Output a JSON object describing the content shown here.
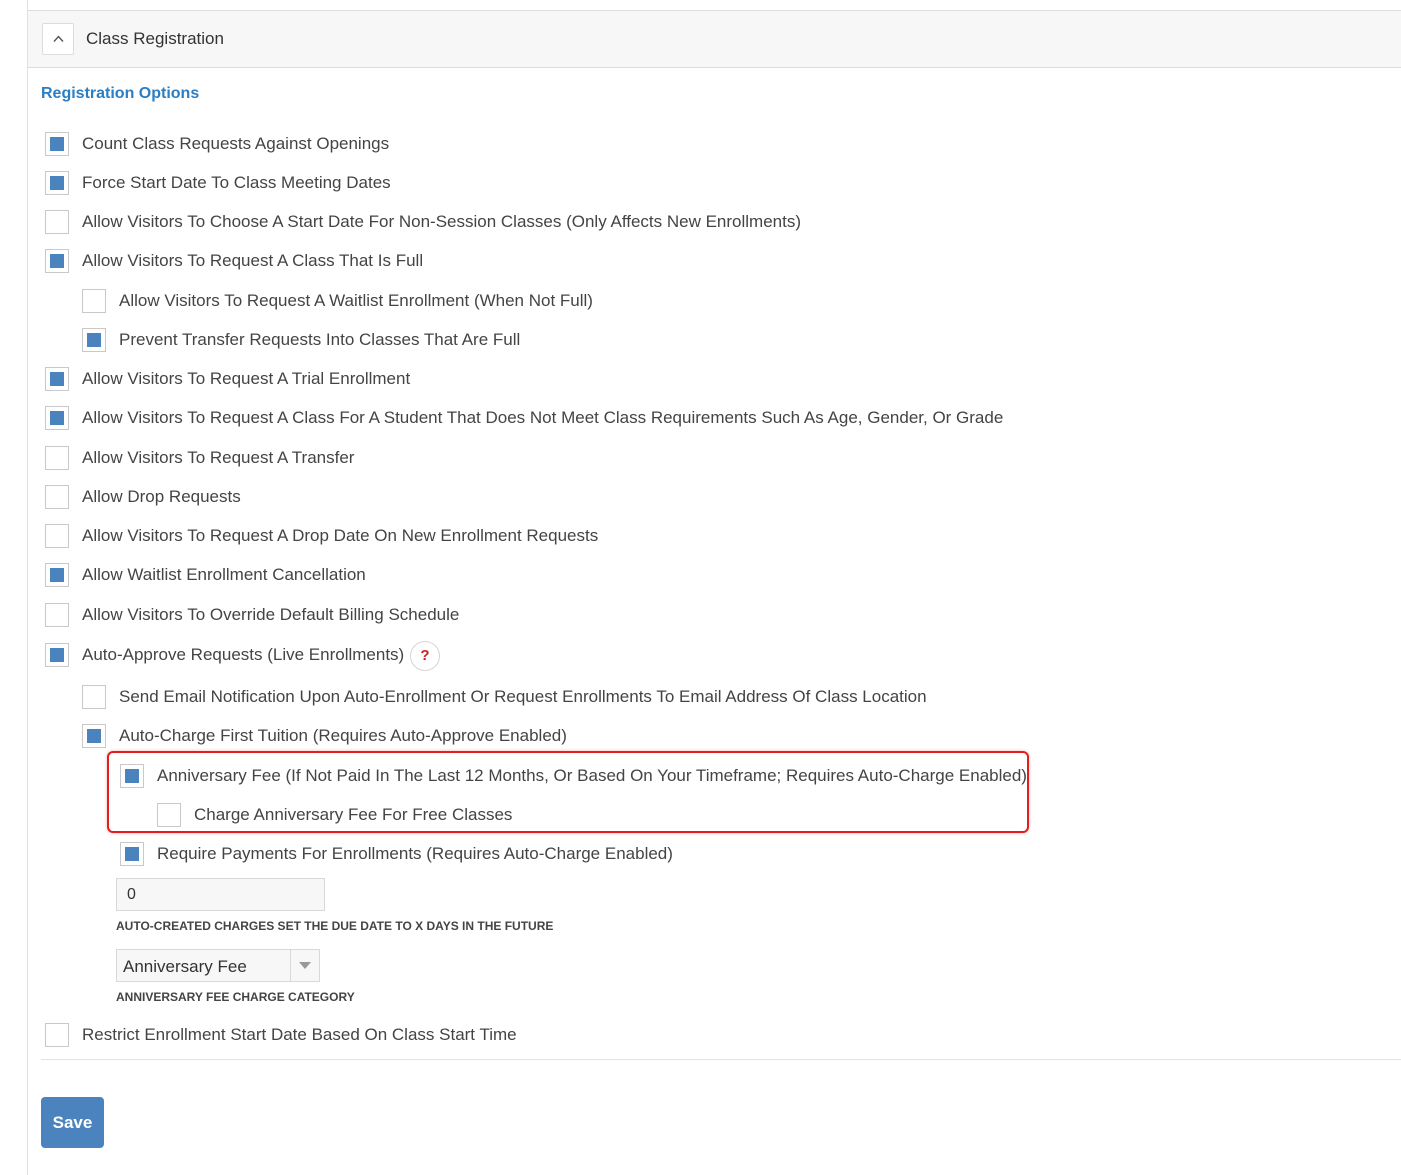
{
  "panel": {
    "title": "Class Registration",
    "section_title": "Registration Options"
  },
  "options": [
    {
      "label": "Count Class Requests Against Openings",
      "checked": true
    },
    {
      "label": "Force Start Date To Class Meeting Dates",
      "checked": true
    },
    {
      "label": "Allow Visitors To Choose A Start Date For Non-Session Classes (Only Affects New Enrollments)",
      "checked": false
    },
    {
      "label": "Allow Visitors To Request A Class That Is Full",
      "checked": true
    },
    {
      "label": "Allow Visitors To Request A Waitlist Enrollment (When Not Full)",
      "checked": false
    },
    {
      "label": "Prevent Transfer Requests Into Classes That Are Full",
      "checked": true
    },
    {
      "label": "Allow Visitors To Request A Trial Enrollment",
      "checked": true
    },
    {
      "label": "Allow Visitors To Request A Class For A Student That Does Not Meet Class Requirements Such As Age, Gender, Or Grade",
      "checked": true
    },
    {
      "label": "Allow Visitors To Request A Transfer",
      "checked": false
    },
    {
      "label": "Allow Drop Requests",
      "checked": false
    },
    {
      "label": "Allow Visitors To Request A Drop Date On New Enrollment Requests",
      "checked": false
    },
    {
      "label": "Allow Waitlist Enrollment Cancellation",
      "checked": true
    },
    {
      "label": "Allow Visitors To Override Default Billing Schedule",
      "checked": false
    },
    {
      "label": "Auto-Approve Requests (Live Enrollments)",
      "checked": true
    },
    {
      "label": "Send Email Notification Upon Auto-Enrollment Or Request Enrollments To Email Address Of Class Location",
      "checked": false
    },
    {
      "label": "Auto-Charge First Tuition (Requires Auto-Approve Enabled)",
      "checked": true
    },
    {
      "label": "Anniversary Fee (If Not Paid In The Last 12 Months, Or Based On Your Timeframe; Requires Auto-Charge Enabled)",
      "checked": true
    },
    {
      "label": "Charge Anniversary Fee For Free Classes",
      "checked": false
    },
    {
      "label": "Require Payments For Enrollments (Requires Auto-Charge Enabled)",
      "checked": true
    },
    {
      "label": "Restrict Enrollment Start Date Based On Class Start Time",
      "checked": false
    }
  ],
  "help_icon": {
    "glyph": "?",
    "icon": "question-circle-icon"
  },
  "due_days": {
    "value": "0",
    "caption": "AUTO-CREATED CHARGES SET THE DUE DATE TO X DAYS IN THE FUTURE"
  },
  "fee_category": {
    "selected": "Anniversary Fee",
    "caption": "ANNIVERSARY FEE CHARGE CATEGORY"
  },
  "save_label": "Save",
  "colors": {
    "accent": "#2a7ec3",
    "checkbox_fill": "#4a83bd",
    "highlight": "#e01e1e",
    "help_mark": "#cc1f1f"
  }
}
